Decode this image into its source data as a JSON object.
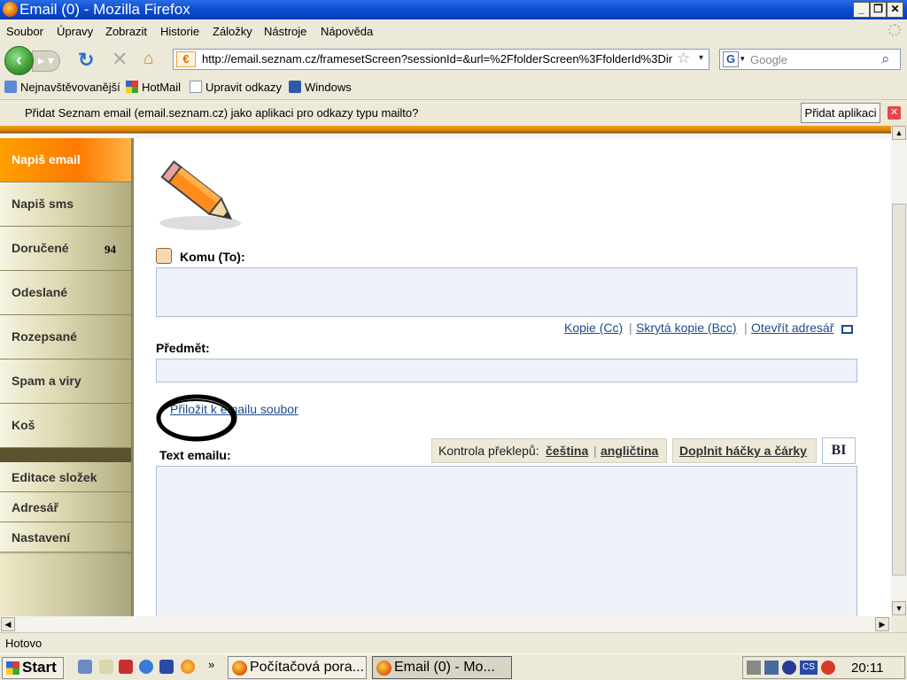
{
  "window": {
    "title": "Email (0) - Mozilla Firefox"
  },
  "menu": [
    "Soubor",
    "Úpravy",
    "Zobrazit",
    "Historie",
    "Záložky",
    "Nástroje",
    "Nápověda"
  ],
  "nav": {
    "url": "http://email.seznam.cz/framesetScreen?sessionId=&url=%2FfolderScreen%3FfolderId%3Dir",
    "search_placeholder": "Google",
    "search_engine_letter": "G"
  },
  "bookmarks": [
    "Nejnavštěvovanější",
    "HotMail",
    "Upravit odkazy",
    "Windows"
  ],
  "notification": {
    "message": "Přidat Seznam email (email.seznam.cz) jako aplikaci pro odkazy typu mailto?",
    "button": "Přidat aplikaci"
  },
  "sidebar": {
    "items": [
      {
        "label": "Napiš email",
        "active": true
      },
      {
        "label": "Napiš sms"
      },
      {
        "label": "Doručené",
        "count": "94"
      },
      {
        "label": "Odeslané"
      },
      {
        "label": "Rozepsané"
      },
      {
        "label": "Spam a viry"
      },
      {
        "label": "Koš"
      }
    ],
    "tools": [
      "Editace složek",
      "Adresář",
      "Nastavení"
    ]
  },
  "compose": {
    "to_label": "Komu (To):",
    "cc_link": "Kopie (Cc)",
    "bcc_link": "Skrytá kopie (Bcc)",
    "addressbook_link": "Otevřít adresář",
    "subject_label": "Předmět:",
    "attach_link": "Přiložit k emailu soubor",
    "body_label": "Text emailu:",
    "spellcheck_label": "Kontrola překlepů:",
    "spell_cs": "čeština",
    "spell_en": "angličtina",
    "diacritics": "Doplnit háčky a čárky",
    "format_toggle": "BI"
  },
  "status": {
    "text": "Hotovo"
  },
  "taskbar": {
    "start": "Start",
    "tasks": [
      "Počítačová pora...",
      "Email (0) - Mo..."
    ],
    "clock": "20:11",
    "tray_lang": "CS"
  },
  "colors": {
    "accent": "#ff8c00",
    "link": "#1e4b8a",
    "field_bg": "#eef2f8"
  }
}
